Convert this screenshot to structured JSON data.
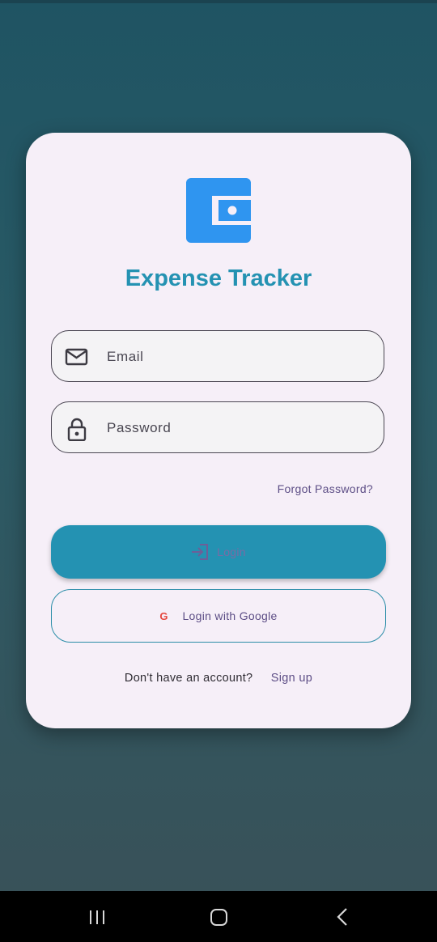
{
  "app": {
    "title": "Expense Tracker",
    "logo_icon": "wallet-icon",
    "accent_color": "#2492b2",
    "logo_color": "#2f95f0"
  },
  "form": {
    "email_placeholder": "Email",
    "email_icon": "mail-icon",
    "password_placeholder": "Password",
    "password_icon": "lock-icon",
    "forgot_label": "Forgot Password?",
    "login_label": "Login",
    "login_icon": "login-arrow-icon",
    "google_icon_text": "G",
    "google_label": "Login with Google",
    "signup_prompt": "Don't have an account?",
    "signup_link": "Sign up"
  },
  "navbar": {
    "recent_icon": "recent-apps-icon",
    "home_icon": "home-icon",
    "back_icon": "back-icon"
  }
}
